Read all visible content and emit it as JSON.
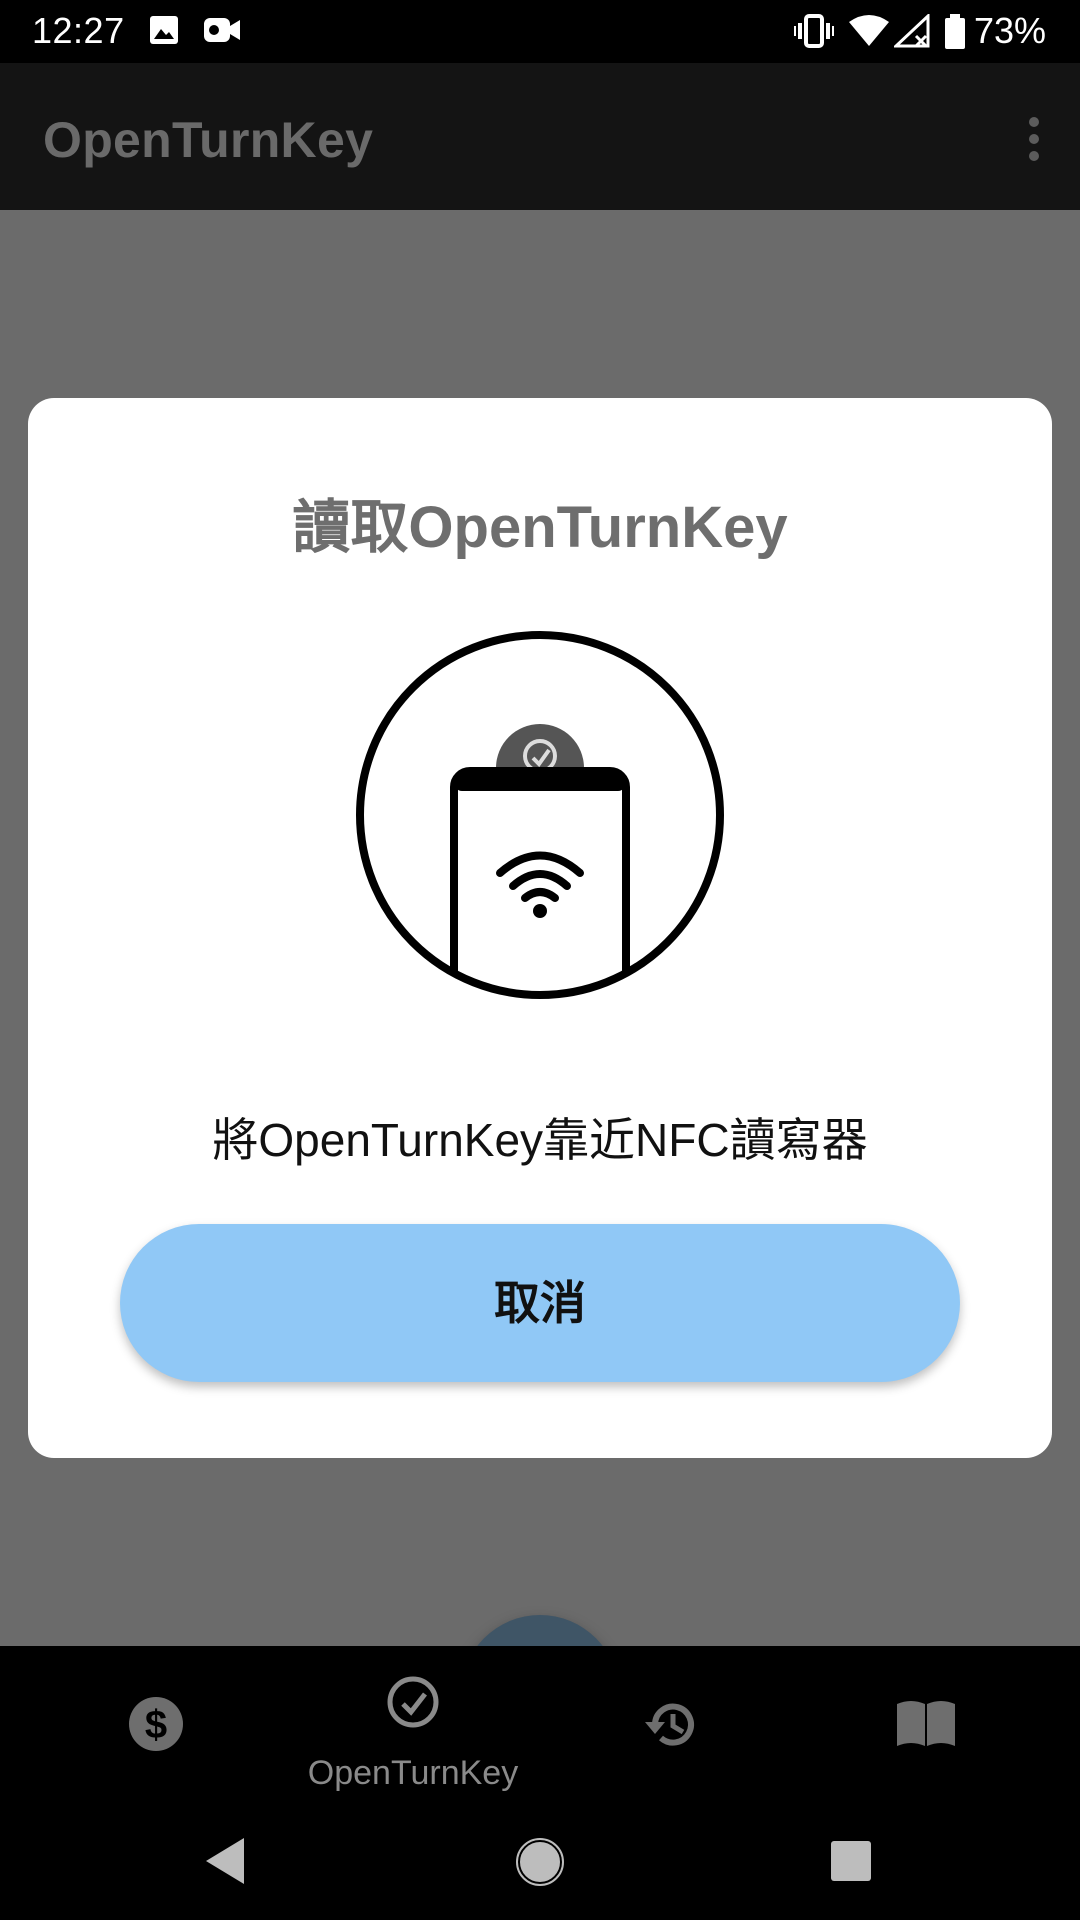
{
  "status_bar": {
    "time": "12:27",
    "battery": "73%",
    "icons": [
      "image-icon",
      "video-icon",
      "vibrate-icon",
      "wifi-icon",
      "signal-off-icon",
      "battery-icon"
    ]
  },
  "app_bar": {
    "title": "OpenTurnKey",
    "menu_icon": "more-vert-icon"
  },
  "dialog": {
    "title": "讀取OpenTurnKey",
    "illustration_icon": "nfc-tap-phone-icon",
    "message": "將OpenTurnKey靠近NFC讀寫器",
    "cancel_label": "取消"
  },
  "bottom_nav": {
    "items": [
      {
        "icon": "dollar-icon",
        "label": ""
      },
      {
        "icon": "openturnkey-icon",
        "label": "OpenTurnKey"
      },
      {
        "icon": "history-icon",
        "label": ""
      },
      {
        "icon": "book-icon",
        "label": ""
      }
    ]
  },
  "colors": {
    "scrim": "#6b6b6b",
    "app_bar": "#141414",
    "dialog_bg": "#ffffff",
    "button": "#90c8f6",
    "fab": "#3f5566"
  }
}
